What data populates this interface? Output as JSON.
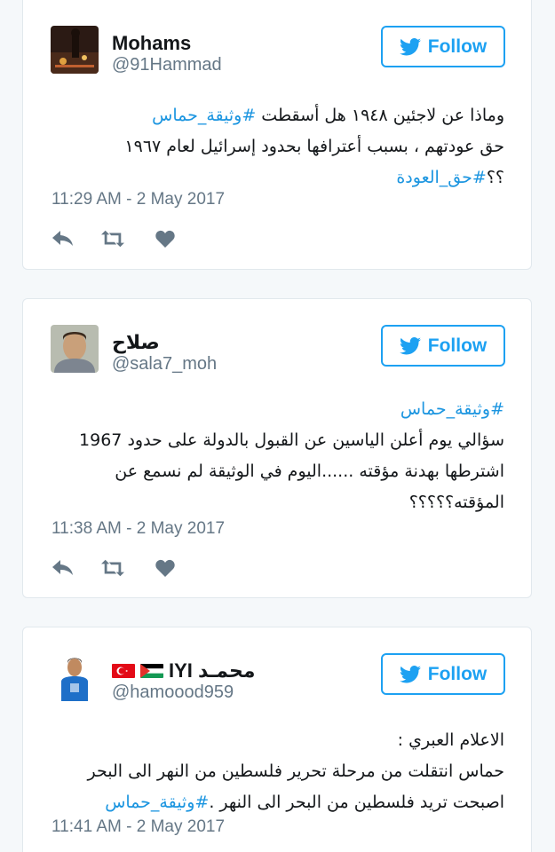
{
  "colors": {
    "accent": "#1da1f2",
    "text": "#14171a",
    "muted": "#657786",
    "border": "#e1e8ed"
  },
  "tweets": [
    {
      "display_name": "Mohams",
      "handle": "@91Hammad",
      "follow_label": "Follow",
      "lines": [
        {
          "text": "وماذا عن لاجئين ١٩٤٨ هل أسقطت ",
          "tag": "#وثيقة_حماس"
        },
        {
          "text": "حق عودتهم ، بسبب أعترافها بحدود إسرائيل لعام ١٩٦٧",
          "tag": ""
        },
        {
          "text": "؟؟",
          "tag": "#حق_العودة"
        }
      ],
      "timestamp": "11:29 AM - 2 May 2017"
    },
    {
      "display_name": "صلاح",
      "handle": "@sala7_moh",
      "follow_label": "Follow",
      "lines": [
        {
          "text": "",
          "tag": "#وثيقة_حماس"
        },
        {
          "text": "سؤالي يوم أعلن الياسين عن القبول بالدولة على حدود 1967",
          "tag": ""
        },
        {
          "text": "اشترطها بهدنة مؤقته ......اليوم في الوثيقة لم نسمع عن",
          "tag": ""
        },
        {
          "text": "المؤقته؟؟؟؟؟",
          "tag": ""
        }
      ],
      "timestamp": "11:38 AM - 2 May 2017"
    },
    {
      "display_name": "IYI محمـد",
      "handle": "@hamoood959",
      "follow_label": "Follow",
      "lines": [
        {
          "text": "الاعلام العبري :",
          "tag": ""
        },
        {
          "text": "حماس انتقلت من مرحلة تحرير فلسطين من النهر الى البحر",
          "tag": ""
        },
        {
          "text": "اصبحت تريد فلسطين من البحر الى النهر .",
          "tag": "#وثيقة_حماس"
        }
      ],
      "timestamp": "11:41 AM - 2 May 2017"
    }
  ],
  "icons": {
    "follow": "twitter-bird-icon",
    "reply": "reply-icon",
    "retweet": "retweet-icon",
    "like": "heart-icon"
  }
}
